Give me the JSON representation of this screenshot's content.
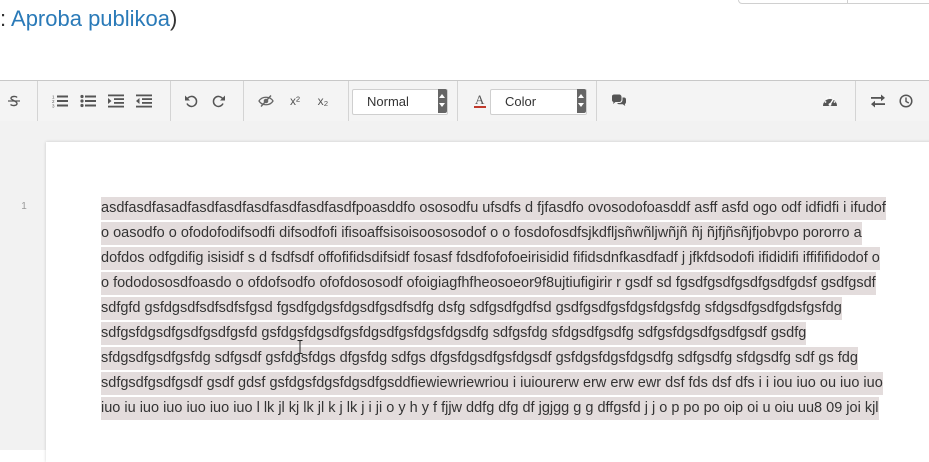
{
  "header": {
    "status_prefix": ": ",
    "status_link": "Aproba publikoa",
    "status_suffix": ")"
  },
  "toolbar": {
    "buttons": [
      {
        "name": "strikethrough-icon"
      },
      {
        "name": "ordered-list-icon"
      },
      {
        "name": "bullet-list-icon"
      },
      {
        "name": "indent-icon"
      },
      {
        "name": "outdent-icon"
      },
      {
        "name": "undo-icon"
      },
      {
        "name": "redo-icon"
      },
      {
        "name": "clear-format-icon"
      },
      {
        "name": "superscript-icon"
      },
      {
        "name": "subscript-icon"
      },
      {
        "name": "comment-icon"
      },
      {
        "name": "dashboard-icon"
      },
      {
        "name": "swap-icon"
      },
      {
        "name": "history-icon"
      }
    ],
    "paragraph_select": "Normal",
    "color_select": "Color",
    "superscript_label": "x²",
    "subscript_label": "x₂"
  },
  "editor": {
    "line_number": "1",
    "text": "asdfasdfasadfasdfasdfasdfasdfasdfasdfpoasddfo ososodfu ufsdfs d fjfasdfo ovosodofoasddf  asff asfd ogo odf idfidfi i ifudof o oasodfo o ofodofodifsodfi difsodfofi ifisoaffsisoisoososodof o o fosdofosdfsjkdfljsñwñljwñjñ ñj ñjfjñsñjfjobvpo pororro a dofdos odfgdifig  isisidf s d fsdfsdf  offofifidsdifsidf fosasf fdsdfofofoeirisidid fifidsdnfkasdfadf  j jfkfdsodofi ifididifi iffififidodof o o fododososdfoasdo o ofdofsodfo ofofdososodf ofoigiagfhfheosoeor9f8ujtiufigirir r  gsdf sd fgsdfgsdfgsdfgsdfgdsf gsdfgsdf sdfgfd gsfdgsdfsdfsdfsfgsd fgsdfgdgsfdgsdfgsdfsdfg dsfg sdfgsdfgdfsd gsdfgsdfgsfdgsfdgsfdg sfdgsdfgsdfgdsfgsfdg sdfgsfdgsdfgsdfgsdfgsfd gsfdgsfdgsdfgsfdgsdfgsfdgsfdgsdfg sdfgsfdg sfdgsdfgsdfg sdfgsfdgsdfgsdfgsdf gsdfg sfdgsdfgsdfgsfdg sdfgsdf gsfdgsfdgs dfgsfdg sdfgs dfgsfdgsdfgsfdgsdf gsfdgsfdgsfdgsdfg sdfgsdfg sfdgsdfg sdf gs fdg sdfgsdfgsdfgsdf gsdf gdsf gsfdgsfdgsfdgsdfgsddfiewiewriewriou i iuiourerw erw erw ewr dsf fds dsf dfs i i iou iuo ou iuo iuo iuo iu iuo iuo iuo iuo iuo l lk jl kj lk jl k j lk   j i ji o y h y      f fjjw ddfg dfg df  jgjgg g g dffgsfd   j j o p po  po oip oi u oiu uu8 09 joi kjl"
  },
  "colors": {
    "link": "#2a7ab8",
    "toolbar_bg": "#f4f4f4",
    "text_highlight": "#e3dcdc",
    "editor_bg": "#f2f2f2"
  }
}
